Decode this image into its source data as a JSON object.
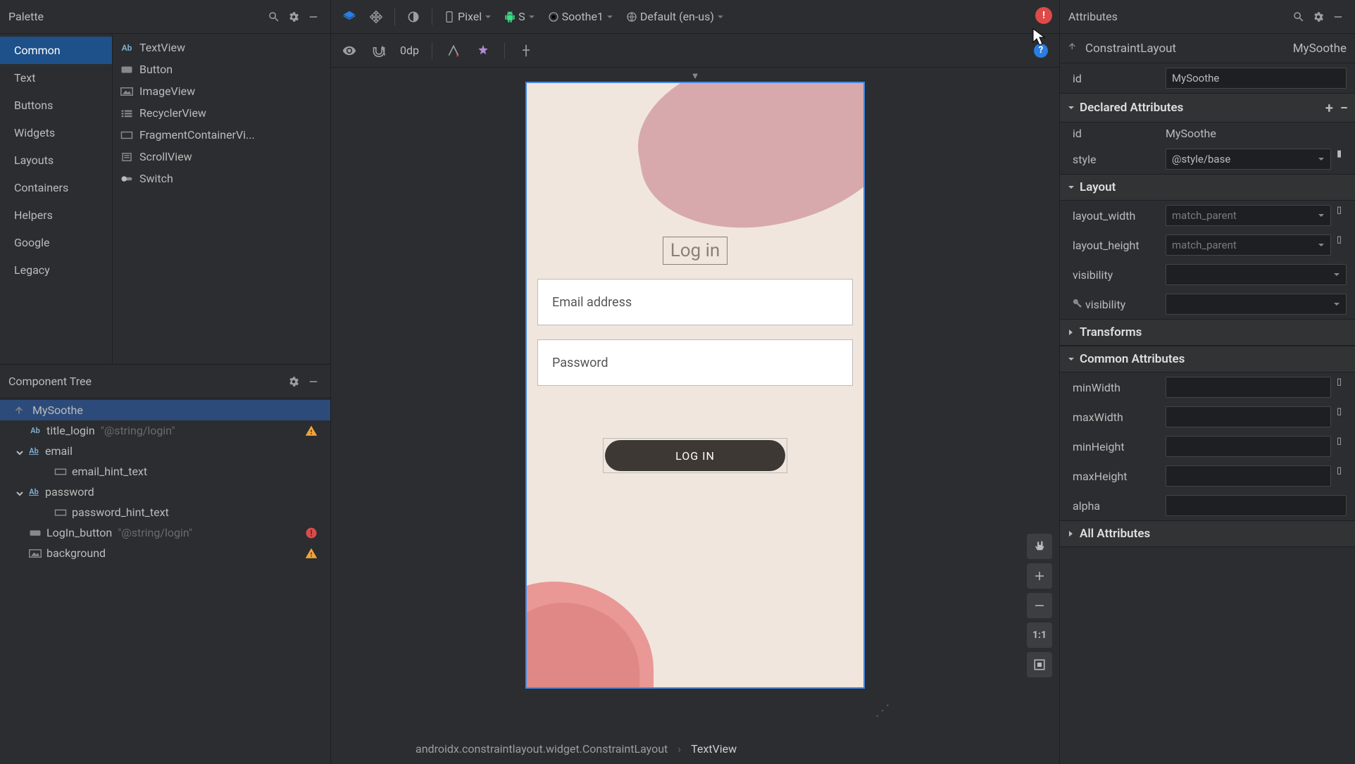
{
  "palette": {
    "title": "Palette",
    "categories": [
      "Common",
      "Text",
      "Buttons",
      "Widgets",
      "Layouts",
      "Containers",
      "Helpers",
      "Google",
      "Legacy"
    ],
    "selectedCategory": "Common",
    "items": [
      {
        "label": "TextView",
        "icon": "ab"
      },
      {
        "label": "Button",
        "icon": "square"
      },
      {
        "label": "ImageView",
        "icon": "image"
      },
      {
        "label": "RecyclerView",
        "icon": "list"
      },
      {
        "label": "FragmentContainerVi...",
        "icon": "frame"
      },
      {
        "label": "ScrollView",
        "icon": "scroll"
      },
      {
        "label": "Switch",
        "icon": "switch"
      }
    ]
  },
  "componentTree": {
    "title": "Component Tree",
    "nodes": [
      {
        "indent": 0,
        "icon": "layout",
        "label": "MySoothe",
        "selected": true
      },
      {
        "indent": 1,
        "icon": "ab",
        "label": "title_login",
        "hint": "\"@string/login\"",
        "badge": "warn"
      },
      {
        "indent": 1,
        "icon": "ab",
        "label": "email",
        "chevron": true
      },
      {
        "indent": 2,
        "icon": "scroll",
        "label": "email_hint_text"
      },
      {
        "indent": 1,
        "icon": "ab",
        "label": "password",
        "chevron": true
      },
      {
        "indent": 2,
        "icon": "scroll",
        "label": "password_hint_text"
      },
      {
        "indent": 1,
        "icon": "scroll",
        "label": "LogIn_button",
        "hint": "\"@string/login\"",
        "badge": "err"
      },
      {
        "indent": 1,
        "icon": "image",
        "label": "background",
        "badge": "warn"
      }
    ]
  },
  "designToolbar": {
    "device": "Pixel",
    "api": "S",
    "theme": "Soothe1",
    "locale": "Default (en-us)",
    "dp": "0dp"
  },
  "preview": {
    "title": "Log in",
    "email_placeholder": "Email address",
    "password_placeholder": "Password",
    "login_button": "LOG IN"
  },
  "sideControls": {
    "ratio": "1:1"
  },
  "breadcrumb": {
    "path": "androidx.constraintlayout.widget.ConstraintLayout",
    "last": "TextView"
  },
  "attributes": {
    "title": "Attributes",
    "componentType": "ConstraintLayout",
    "componentName": "MySoothe",
    "id_label": "id",
    "id_value": "MySoothe",
    "sections": {
      "declared": "Declared Attributes",
      "layout": "Layout",
      "transforms": "Transforms",
      "common": "Common Attributes",
      "all": "All Attributes"
    },
    "declared": {
      "id_label": "id",
      "id_value": "MySoothe",
      "style_label": "style",
      "style_value": "@style/base"
    },
    "layout": {
      "width_label": "layout_width",
      "width_value": "match_parent",
      "height_label": "layout_height",
      "height_value": "match_parent",
      "visibility_label": "visibility",
      "tools_visibility_label": "visibility"
    },
    "common": {
      "minWidth": "minWidth",
      "maxWidth": "maxWidth",
      "minHeight": "minHeight",
      "maxHeight": "maxHeight",
      "alpha": "alpha"
    }
  }
}
